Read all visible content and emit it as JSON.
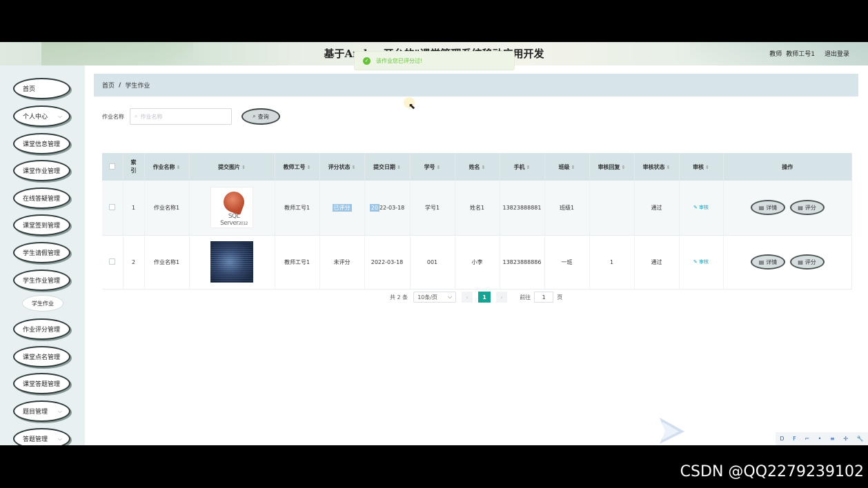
{
  "header": {
    "title": "基于Andro  开台的\"课堂管理系统移动应用开发",
    "role": "教师",
    "username": "教师工号1",
    "logout": "退出登录"
  },
  "toast": {
    "message": "该作业您已评分过!"
  },
  "sidebar": {
    "items": [
      {
        "label": "首页"
      },
      {
        "label": "个人中心",
        "has_children": true
      },
      {
        "label": "课堂信息管理"
      },
      {
        "label": "课堂作业管理"
      },
      {
        "label": "在线答疑管理"
      },
      {
        "label": "课堂签到管理"
      },
      {
        "label": "学生请假管理"
      },
      {
        "label": "学生作业管理"
      },
      {
        "label": "作业评分管理"
      },
      {
        "label": "课堂点名管理"
      },
      {
        "label": "课堂答题管理"
      },
      {
        "label": "题目管理",
        "has_children": true
      },
      {
        "label": "答题管理",
        "has_children": true
      }
    ],
    "subitem": {
      "label": "学生作业"
    }
  },
  "breadcrumb": {
    "home": "首页",
    "sep": "/",
    "current": "学生作业"
  },
  "search": {
    "label": "作业名称",
    "placeholder": "作业名称",
    "button": "查询"
  },
  "table": {
    "headers": [
      "索引",
      "作业名称",
      "提交图片",
      "教师工号",
      "评分状态",
      "提交日期",
      "学号",
      "姓名",
      "手机",
      "班级",
      "审核回复",
      "审核状态",
      "审核",
      "操作"
    ],
    "rows": [
      {
        "index": "1",
        "name": "作业名称1",
        "image": "SQL Server 2012",
        "teacher": "教师工号1",
        "score_status": "已评分",
        "date_hl": "20",
        "date_rest": "22-03-18",
        "student_no": "学号1",
        "student_name": "姓名1",
        "phone": "13823888881",
        "class": "班级1",
        "reply": "",
        "audit_status": "通过",
        "audit": "审核"
      },
      {
        "index": "2",
        "name": "作业名称1",
        "image": "",
        "teacher": "教师工号1",
        "score_status": "未评分",
        "date_hl": "",
        "date_rest": "2022-03-18",
        "student_no": "001",
        "student_name": "小李",
        "phone": "13823888886",
        "class": "一班",
        "reply": "1",
        "audit_status": "通过",
        "audit": "审核"
      }
    ],
    "actions": {
      "detail": "详情",
      "score": "评分"
    }
  },
  "pagination": {
    "total": "共 2 条",
    "page_size": "10条/页",
    "current_page": "1",
    "goto_label": "前往",
    "goto_value": "1",
    "page_suffix": "页"
  },
  "tray": {
    "items": [
      "D",
      "F",
      "⌐",
      "•",
      "≡",
      "✢",
      "🔧"
    ]
  },
  "watermark": "CSDN @QQ2279239102"
}
